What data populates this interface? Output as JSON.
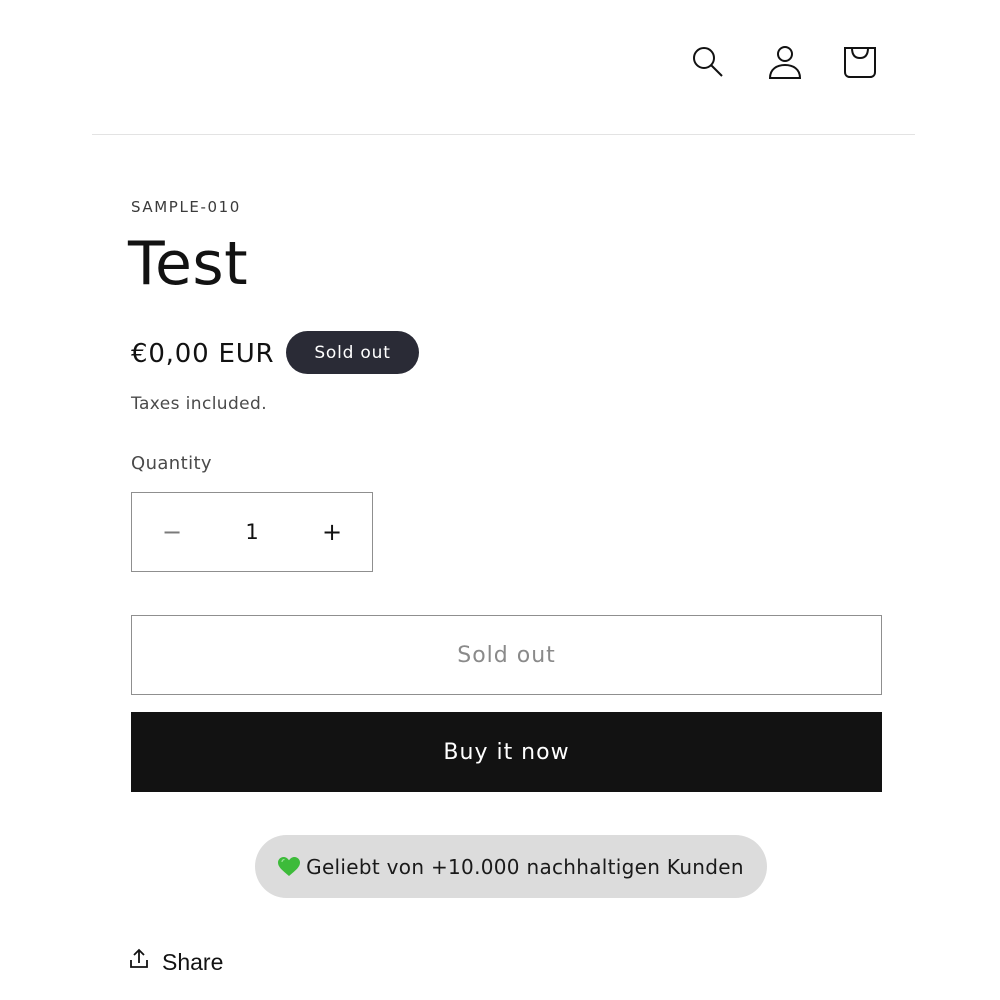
{
  "header": {
    "icons": [
      "search-icon",
      "account-icon",
      "cart-icon"
    ]
  },
  "product": {
    "sku": "SAMPLE-010",
    "title": "Test",
    "price": "€0,00 EUR",
    "badge": "Sold out",
    "tax_note": "Taxes included."
  },
  "quantity": {
    "label": "Quantity",
    "value": "1",
    "minus": "−",
    "plus": "+"
  },
  "buttons": {
    "sold_out": "Sold out",
    "buy_now": "Buy it now"
  },
  "social_proof": {
    "text": "Geliebt von +10.000 nachhaltigen Kunden",
    "icon": "green-heart-icon"
  },
  "share": {
    "label": "Share",
    "icon": "share-icon"
  },
  "colors": {
    "badge_bg": "#2a2b36",
    "buy_button_bg": "#121212",
    "pill_bg": "#dcdcdc",
    "heart": "#3dbb3a"
  }
}
